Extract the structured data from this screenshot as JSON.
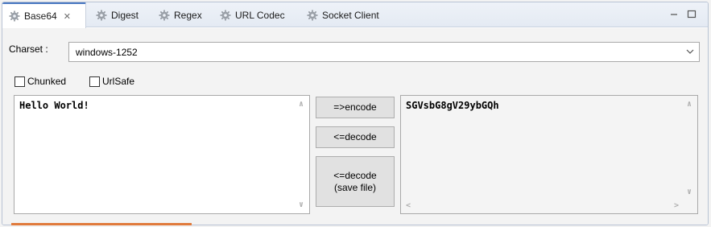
{
  "tabs": [
    {
      "label": "Base64",
      "icon": "gear-icon",
      "active": true
    },
    {
      "label": "Digest",
      "icon": "gear-icon"
    },
    {
      "label": "Regex",
      "icon": "gear-icon"
    },
    {
      "label": "URL Codec",
      "icon": "gear-icon"
    },
    {
      "label": "Socket Client",
      "icon": "gear-icon"
    }
  ],
  "charset": {
    "label": "Charset :",
    "value": "windows-1252"
  },
  "options": {
    "chunked": "Chunked",
    "urlsafe": "UrlSafe"
  },
  "input_text": "Hello World!",
  "output_text": "SGVsbG8gV29ybGQh",
  "buttons": {
    "encode": "=>encode",
    "decode": "<=decode",
    "decode_file_line1": "<=decode",
    "decode_file_line2": "(save file)"
  },
  "colors": {
    "accent": "#4a78c2",
    "orange": "#e07a3c"
  }
}
